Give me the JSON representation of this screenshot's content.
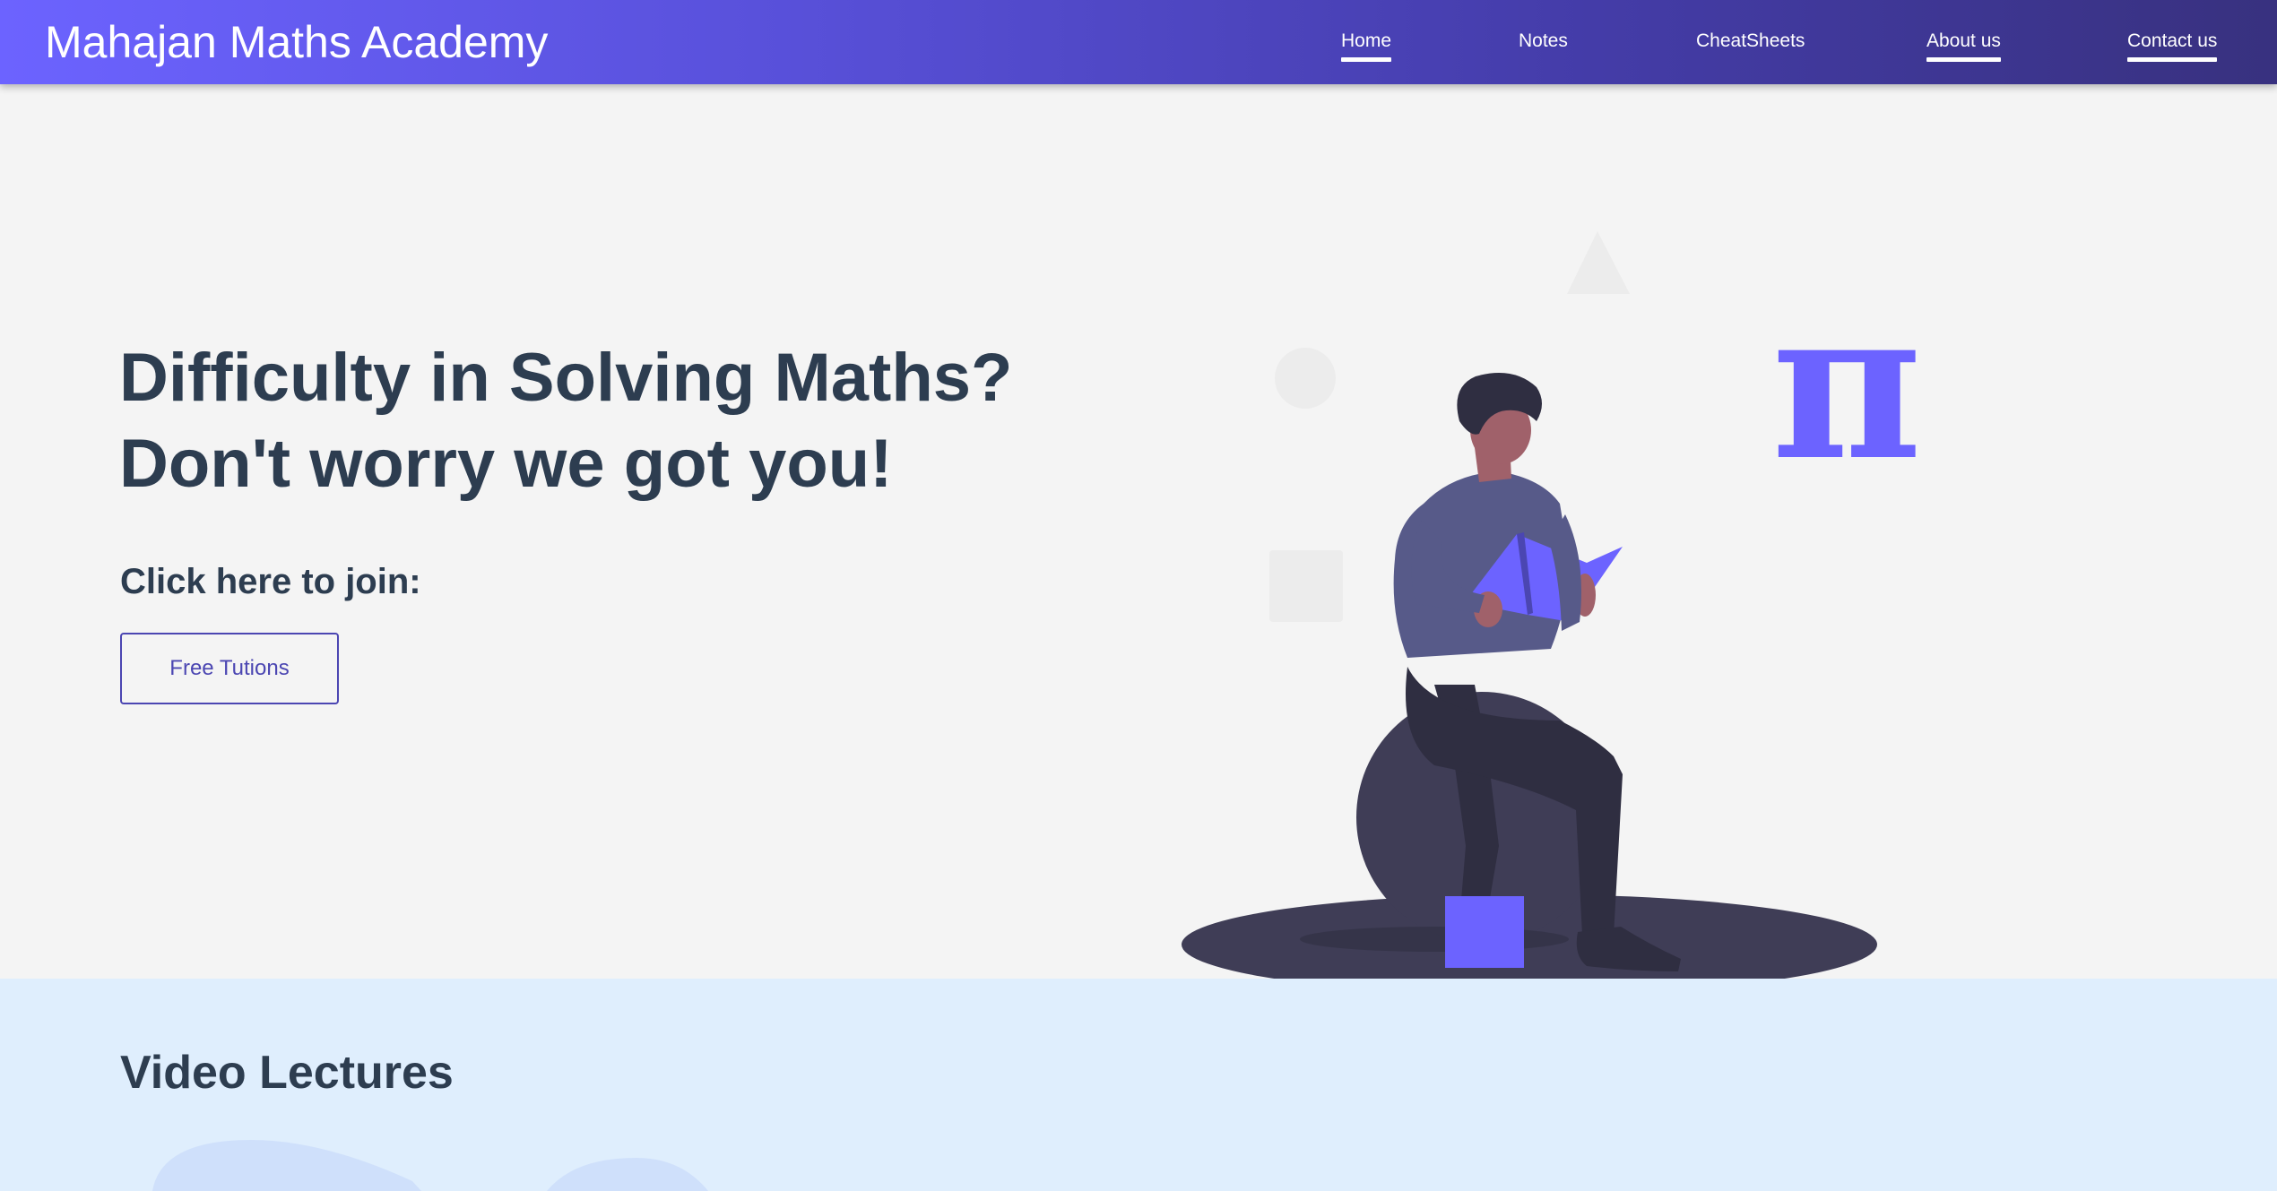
{
  "brand": "Mahajan Maths Academy",
  "nav": {
    "items": [
      {
        "label": "Home",
        "underlined": true
      },
      {
        "label": "Notes",
        "underlined": false
      },
      {
        "label": "CheatSheets",
        "underlined": false
      },
      {
        "label": "About us",
        "underlined": true
      },
      {
        "label": "Contact us",
        "underlined": true
      }
    ]
  },
  "hero": {
    "headline_line1": "Difficulty in Solving Maths?",
    "headline_line2": "Don't worry we got you!",
    "join_prompt": "Click here to join:",
    "join_button": "Free Tutions"
  },
  "illustration": {
    "pi_symbol": "π"
  },
  "videos": {
    "title": "Video Lectures"
  },
  "colors": {
    "accent": "#6c63ff",
    "nav_gradient_end": "#38317f",
    "text_dark": "#2d3d50",
    "hero_bg": "#f4f4f4",
    "section_bg": "#dfeefd"
  }
}
